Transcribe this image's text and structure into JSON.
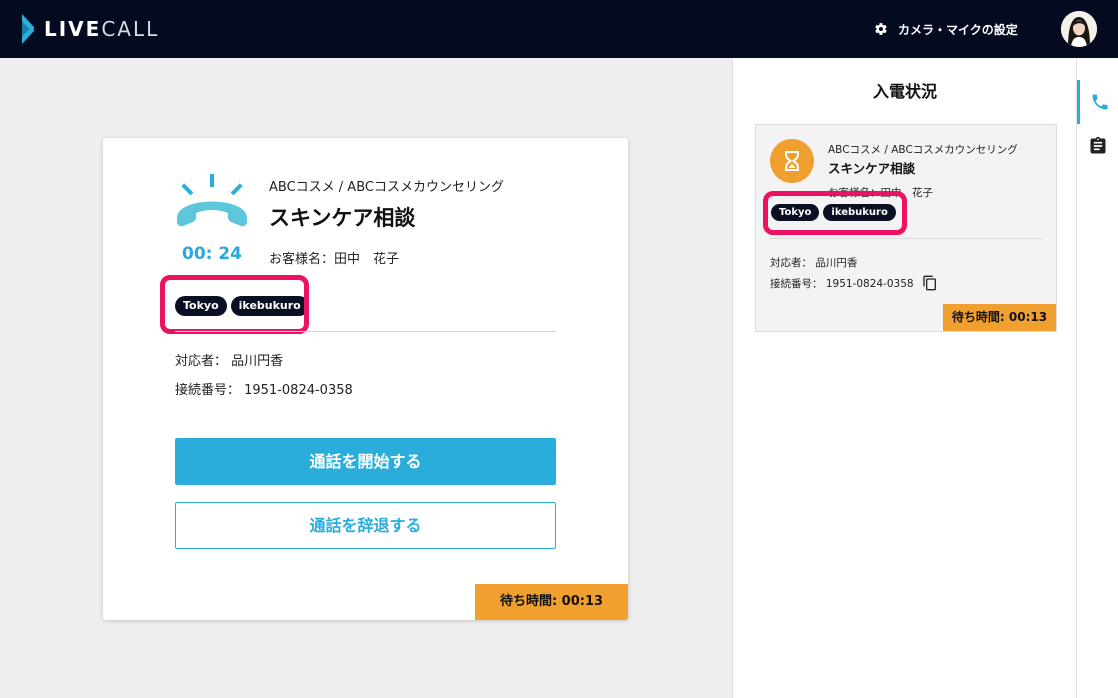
{
  "header": {
    "logo_bold": "LIVE",
    "logo_thin": "CALL",
    "settings_label": "カメラ・マイクの設定",
    "settings_icon": "gear-icon",
    "avatar_icon": "user-avatar"
  },
  "call": {
    "timer": "00: 24",
    "company": "ABCコスメ / ABCコスメカウンセリング",
    "service": "スキンケア相談",
    "customer": "お客様名：田中　花子",
    "tags": [
      "Tokyo",
      "ikebukuro"
    ],
    "staff": "対応者：  品川円香",
    "connection": "接続番号：  1951-0824-0358",
    "start_button": "通話を開始する",
    "decline_button": "通話を辞退する",
    "wait_time": "待ち時間: 00:13"
  },
  "panel": {
    "title": "入電状況",
    "company": "ABCコスメ / ABCコスメカウンセリング",
    "service": "スキンケア相談",
    "customer": "お客様名：田中　花子",
    "tags": [
      "Tokyo",
      "ikebukuro"
    ],
    "staff": "対応者：  品川円香",
    "connection": "接続番号：  1951-0824-0358",
    "wait_time": "待ち時間: 00:13"
  },
  "rail": {
    "tabs": [
      "phone-icon",
      "clipboard-icon"
    ]
  },
  "colors": {
    "header_bg": "#040a1f",
    "accent": "#2aaddb",
    "wait_badge": "#f0a02e",
    "highlight": "#ec1262",
    "tag_bg": "#0b0f24"
  }
}
